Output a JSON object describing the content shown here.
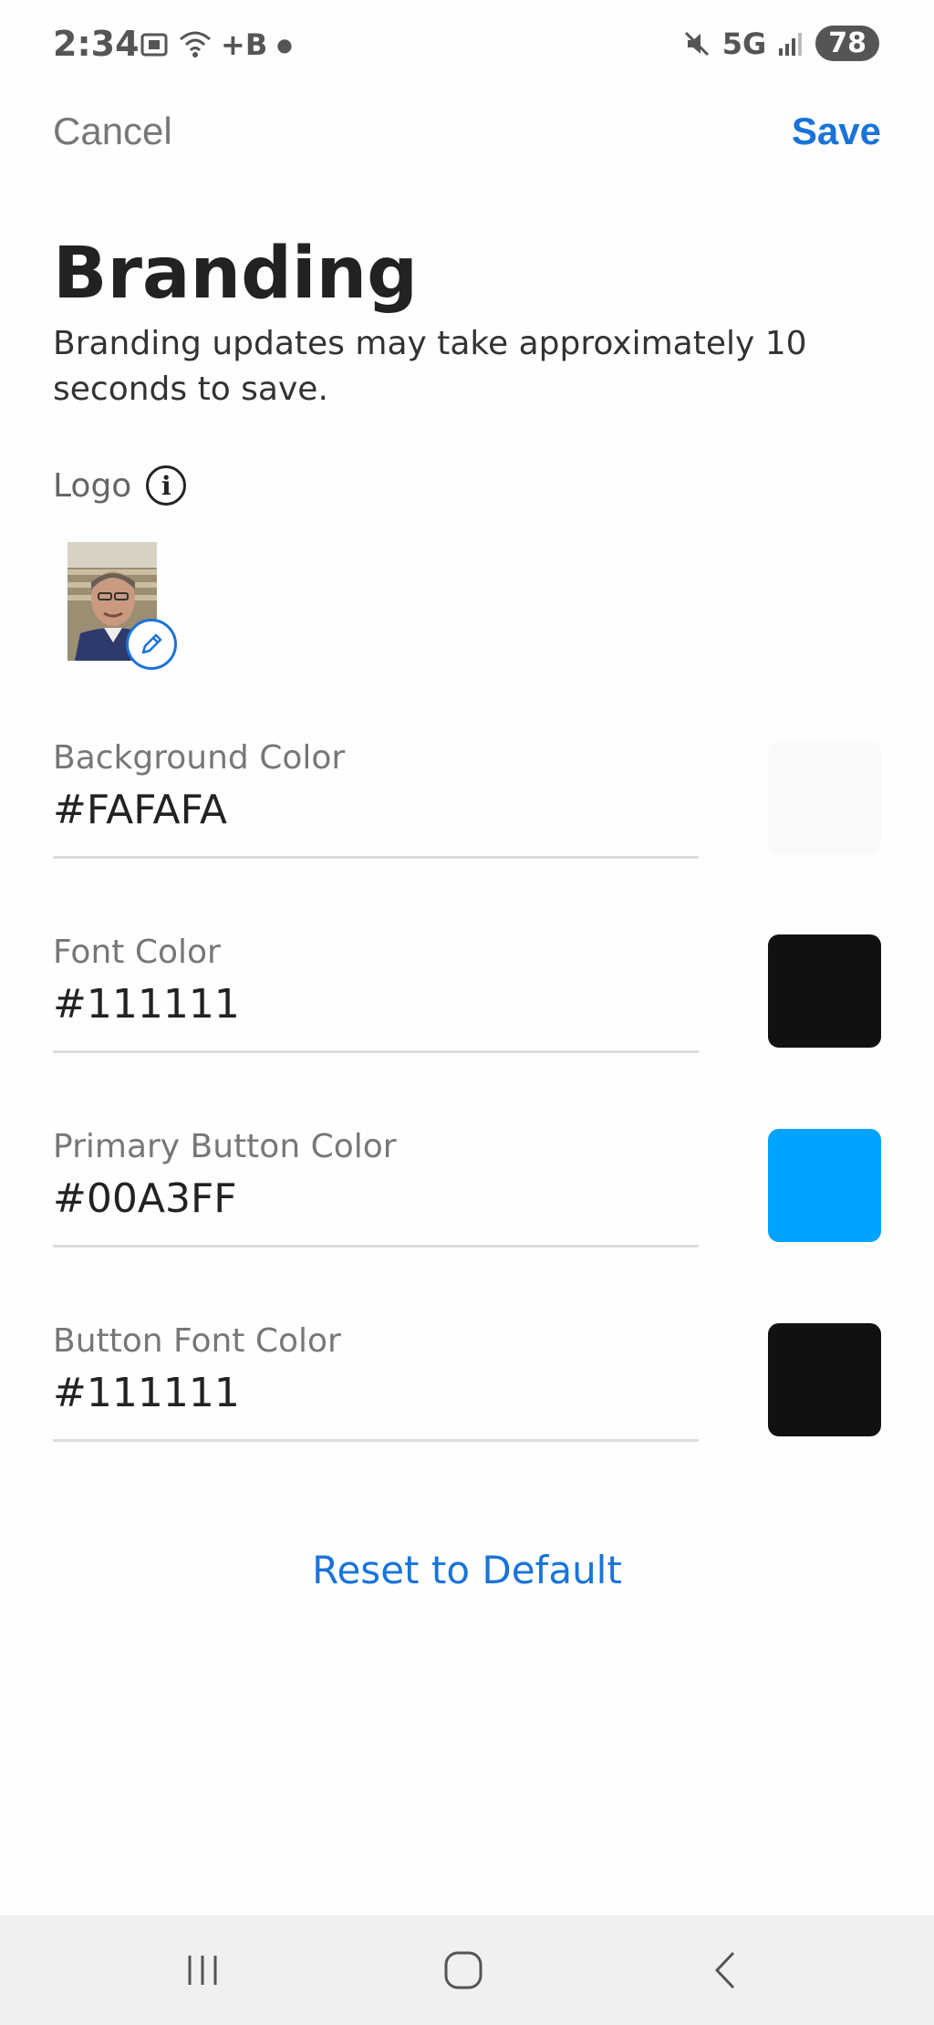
{
  "status_bar": {
    "time": "2:34",
    "left_extra": "+B",
    "network": "5G",
    "battery": "78"
  },
  "header": {
    "cancel_label": "Cancel",
    "save_label": "Save"
  },
  "page": {
    "title": "Branding",
    "subtitle": "Branding updates may take approximately 10 seconds to save.",
    "logo_label": "Logo"
  },
  "fields": [
    {
      "label": "Background Color",
      "value": "#FAFAFA",
      "swatch": "#FAFAFA"
    },
    {
      "label": "Font Color",
      "value": "#111111",
      "swatch": "#111111"
    },
    {
      "label": "Primary Button Color",
      "value": "#00A3FF",
      "swatch": "#00A3FF"
    },
    {
      "label": "Button Font Color",
      "value": "#111111",
      "swatch": "#111111"
    }
  ],
  "reset_label": "Reset to Default",
  "colors": {
    "accent": "#1a73d9"
  },
  "icons": [
    "screenshot-icon",
    "wifi-icon",
    "mute-icon",
    "signal-icon",
    "info-icon",
    "pencil-icon",
    "recent-apps-icon",
    "home-icon",
    "back-icon"
  ]
}
